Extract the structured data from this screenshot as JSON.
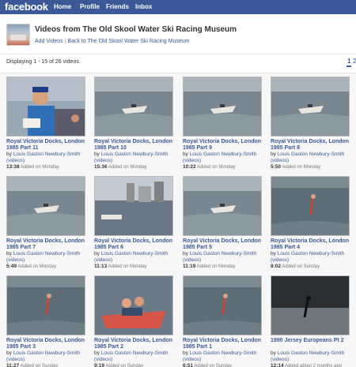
{
  "topbar": {
    "logo": "facebook",
    "nav": [
      "Home",
      "Profile",
      "Friends",
      "Inbox"
    ]
  },
  "header": {
    "title": "Videos from The Old Skool Water Ski Racing Museum",
    "add_videos": "Add Videos",
    "separator": "|",
    "back_link": "Back to The Old Skool Water Ski Racing Museum"
  },
  "info": {
    "displaying": "Displaying 1 - 15 of 26 videos.",
    "page_current": "1",
    "page_next": "2"
  },
  "videos": [
    {
      "title": "Royal Victoria Docks, London 1985 Part 11",
      "by_prefix": "by",
      "author": "Louis Gaston Newbury-Smith",
      "videos_link": "(videos)",
      "duration": "13:38",
      "added": "Added on Monday",
      "thumb": "presenter"
    },
    {
      "title": "Royal Victoria Docks, London 1985 Part 10",
      "by_prefix": "by",
      "author": "Louis Gaston Newbury-Smith",
      "videos_link": "(videos)",
      "duration": "15:36",
      "added": "Added on Monday",
      "thumb": "boat"
    },
    {
      "title": "Royal Victoria Docks, London 1985 Part 9",
      "by_prefix": "by",
      "author": "Louis Gaston Newbury-Smith",
      "videos_link": "(videos)",
      "duration": "10:22",
      "added": "Added on Monday",
      "thumb": "boat"
    },
    {
      "title": "Royal Victoria Docks, London 1985 Part 8",
      "by_prefix": "by",
      "author": "Louis Gaston Newbury-Smith",
      "videos_link": "(videos)",
      "duration": "5:50",
      "added": "Added on Monday",
      "thumb": "boat"
    },
    {
      "title": "Royal Victoria Docks, London 1985 Part 7",
      "by_prefix": "by",
      "author": "Louis Gaston Newbury-Smith",
      "videos_link": "(videos)",
      "duration": "5:49",
      "added": "Added on Monday",
      "thumb": "boat"
    },
    {
      "title": "Royal Victoria Docks, London 1985 Part 6",
      "by_prefix": "by",
      "author": "Louis Gaston Newbury-Smith",
      "videos_link": "(videos)",
      "duration": "11:13",
      "added": "Added on Monday",
      "thumb": "docks"
    },
    {
      "title": "Royal Victoria Docks, London 1985 Part 5",
      "by_prefix": "by",
      "author": "Louis Gaston Newbury-Smith",
      "videos_link": "(videos)",
      "duration": "11:19",
      "added": "Added on Monday",
      "thumb": "boat"
    },
    {
      "title": "Royal Victoria Docks, London 1985 Part 4",
      "by_prefix": "by",
      "author": "Louis Gaston Newbury-Smith",
      "videos_link": "(videos)",
      "duration": "8:02",
      "added": "Added on Sunday",
      "thumb": "skier"
    },
    {
      "title": "Royal Victoria Docks, London 1985 Part 3",
      "by_prefix": "by",
      "author": "Louis Gaston Newbury-Smith",
      "videos_link": "(videos)",
      "duration": "11:27",
      "added": "Added on Sunday",
      "thumb": "skier"
    },
    {
      "title": "Royal Victoria Docks, London 1985 Part 2",
      "by_prefix": "by",
      "author": "Louis Gaston Newbury-Smith",
      "videos_link": "(videos)",
      "duration": "9:19",
      "added": "Added on Sunday",
      "thumb": "redboat"
    },
    {
      "title": "Royal Victoria Docks, London 1985 Part 1",
      "by_prefix": "by",
      "author": "Louis Gaston Newbury-Smith",
      "videos_link": "(videos)",
      "duration": "6:51",
      "added": "Added on Sunday",
      "thumb": "skier"
    },
    {
      "title": "1990 Jersey Europeans Pt 2",
      "by_prefix": "by",
      "author": "Louis Gaston Newbury-Smith",
      "videos_link": "(videos)",
      "duration": "12:14",
      "added": "Added about 2 months ago",
      "thumb": "dark"
    }
  ],
  "colors": {
    "brand": "#3b5998",
    "link": "#3b5998",
    "page_bg": "#ffffff",
    "grid_bg": "#f7f7f7"
  }
}
